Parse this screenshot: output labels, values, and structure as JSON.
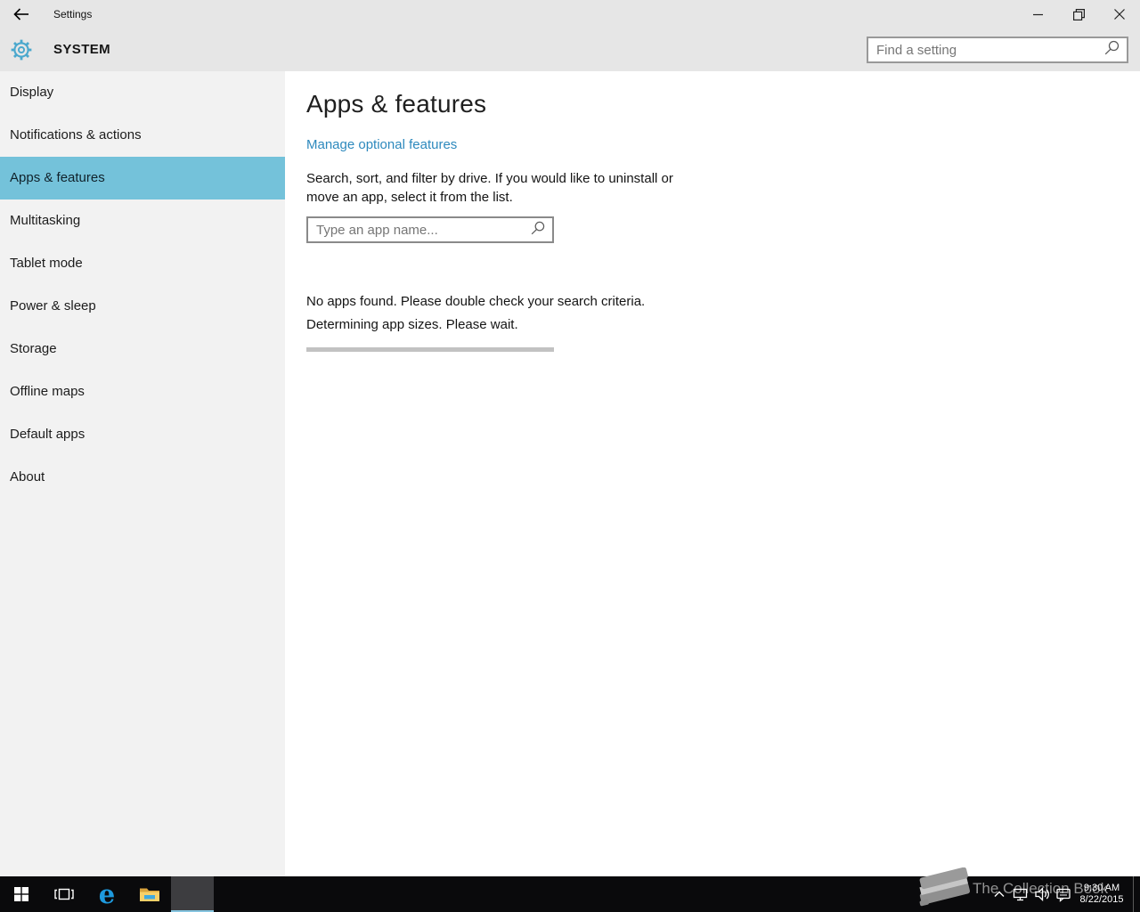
{
  "window": {
    "title": "Settings"
  },
  "header": {
    "title": "SYSTEM",
    "search_placeholder": "Find a setting"
  },
  "sidebar": {
    "items": [
      {
        "label": "Display",
        "selected": false
      },
      {
        "label": "Notifications & actions",
        "selected": false
      },
      {
        "label": "Apps & features",
        "selected": true
      },
      {
        "label": "Multitasking",
        "selected": false
      },
      {
        "label": "Tablet mode",
        "selected": false
      },
      {
        "label": "Power & sleep",
        "selected": false
      },
      {
        "label": "Storage",
        "selected": false
      },
      {
        "label": "Offline maps",
        "selected": false
      },
      {
        "label": "Default apps",
        "selected": false
      },
      {
        "label": "About",
        "selected": false
      }
    ]
  },
  "main": {
    "heading": "Apps & features",
    "manage_link": "Manage optional features",
    "description_lines": [
      "Search, sort, and filter by drive. If you would like to uninstall or",
      "move an app, select it from the list."
    ],
    "app_search_placeholder": "Type an app name...",
    "status_no_apps": "No apps found. Please double check your search criteria.",
    "status_sizes": "Determining app sizes. Please wait."
  },
  "taskbar": {
    "watermark": "The Collection Book",
    "clock": {
      "time": "9:30 AM",
      "date": "8/22/2015"
    },
    "icons": {
      "left": [
        "start-icon",
        "task-view-icon",
        "edge-icon",
        "file-explorer-icon",
        "settings-app-tile"
      ],
      "tray": [
        "chevron-up-icon",
        "network-icon",
        "speaker-icon",
        "action-center-icon"
      ]
    }
  },
  "colors": {
    "accent": "#4ba8cd",
    "selected_bg": "#74c2da",
    "link": "#2d89bd",
    "header_bg": "#e6e6e6",
    "sidebar_bg": "#f2f2f2",
    "taskbar_bg": "#0a0a0c",
    "active_underline": "#86c5e0",
    "progress": "#c2c2c2"
  }
}
